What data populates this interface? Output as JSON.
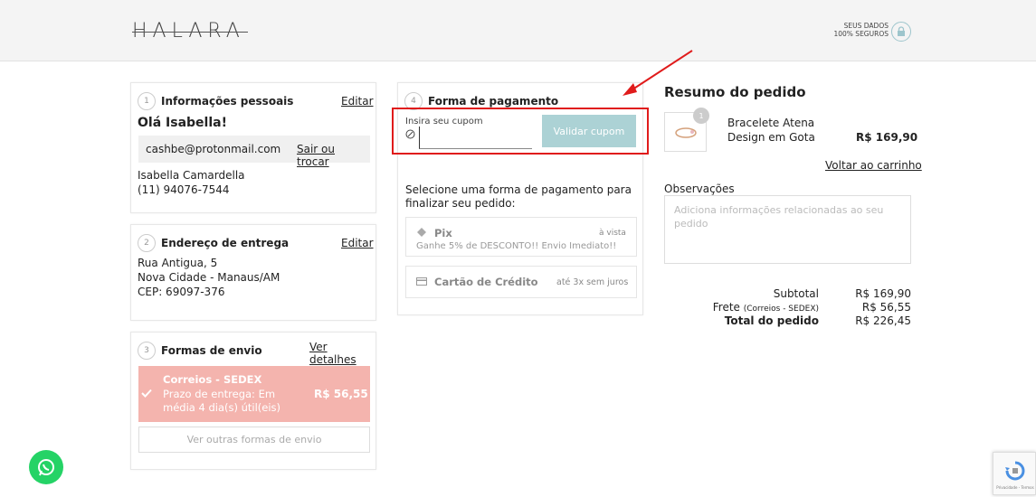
{
  "header": {
    "logo": "HALARA",
    "secure_line1": "SEUS DADOS",
    "secure_line2": "100% SEGUROS"
  },
  "personal": {
    "step": "1",
    "title": "Informações pessoais",
    "edit": "Editar",
    "greeting": "Olá Isabella!",
    "email": "cashbe@protonmail.com",
    "switch": "Sair ou trocar",
    "name": "Isabella Camardella",
    "phone": "(11) 94076-7544"
  },
  "address": {
    "step": "2",
    "title": "Endereço de entrega",
    "edit": "Editar",
    "line1": "Rua Antigua, 5",
    "line2": "Nova Cidade - Manaus/AM",
    "line3": "CEP: 69097-376"
  },
  "shipping": {
    "step": "3",
    "title": "Formas de envio",
    "details": "Ver detalhes",
    "option_name": "Correios - SEDEX",
    "option_desc1": "Prazo de entrega: Em",
    "option_desc2": "média 4 dia(s) útil(eis)",
    "option_price": "R$ 56,55",
    "other": "Ver outras formas de envio"
  },
  "payment": {
    "step": "4",
    "title": "Forma de pagamento",
    "coupon_label": "Insira seu cupom",
    "coupon_value": "",
    "validate": "Validar cupom",
    "prompt1": "Selecione uma forma de pagamento para",
    "prompt2": "finalizar seu pedido:",
    "pix_name": "Pix",
    "pix_tag": "à vista",
    "pix_desc": "Ganhe 5% de DESCONTO!! Envio Imediato!!",
    "card_name": "Cartão de Crédito",
    "card_tag": "até 3x sem juros"
  },
  "summary": {
    "title": "Resumo do pedido",
    "item_qty": "1",
    "item_name1": "Bracelete Atena",
    "item_name2": "Design em Gota",
    "item_price": "R$ 169,90",
    "back": "Voltar ao carrinho",
    "obs_label": "Observações",
    "obs_placeholder": "Adiciona informações relacionadas ao seu pedido",
    "subtotal_label": "Subtotal",
    "subtotal_value": "R$ 169,90",
    "shipping_label": "Frete",
    "shipping_method": "(Correios - SEDEX)",
    "shipping_value": "R$ 56,55",
    "total_label": "Total do pedido",
    "total_value": "R$ 226,45"
  },
  "recaptcha": {
    "text": "Privacidade - Termos"
  },
  "colors": {
    "accent": "#acd2d5",
    "sedex": "#f4b4ae",
    "highlight": "#e01b1b"
  }
}
